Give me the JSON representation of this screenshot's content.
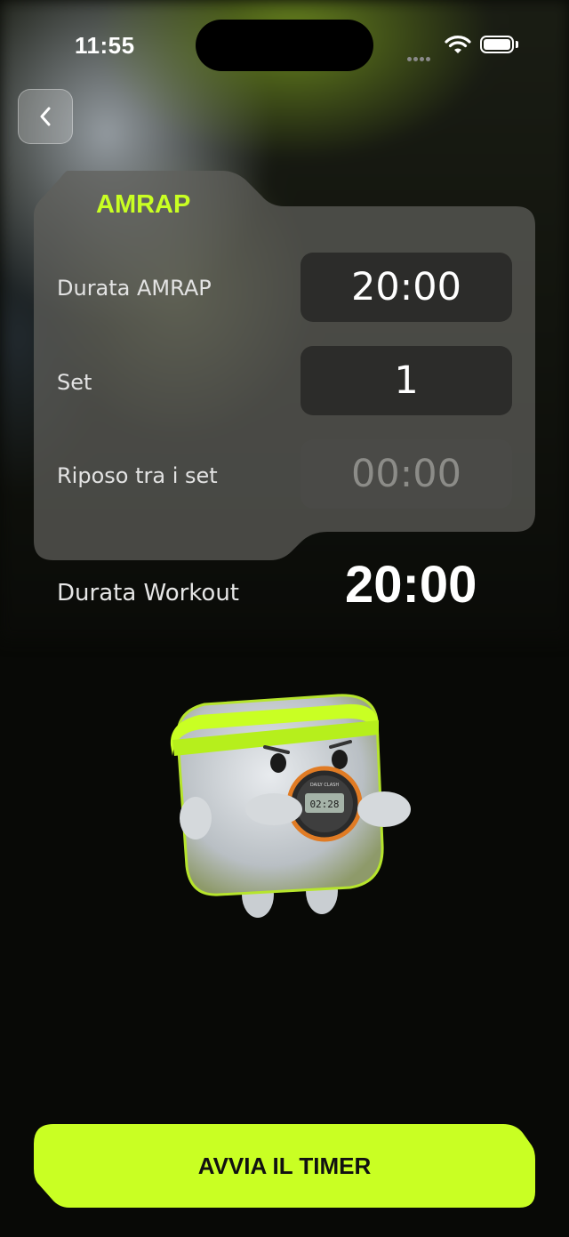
{
  "status_bar": {
    "time": "11:55"
  },
  "card": {
    "title": "AMRAP",
    "rows": [
      {
        "label": "Durata AMRAP",
        "value": "20:00"
      },
      {
        "label": "Set",
        "value": "1"
      },
      {
        "label": "Riposo tra i set",
        "value": "00:00"
      }
    ]
  },
  "summary": {
    "label": "Durata Workout",
    "value": "20:00"
  },
  "mascot": {
    "watch_brand": "DAILY CLASH",
    "watch_time": "02:28"
  },
  "actions": {
    "start_label": "AVVIA IL TIMER"
  },
  "colors": {
    "accent": "#c9ff23",
    "background": "#080906",
    "field": "#2c2c2a"
  }
}
